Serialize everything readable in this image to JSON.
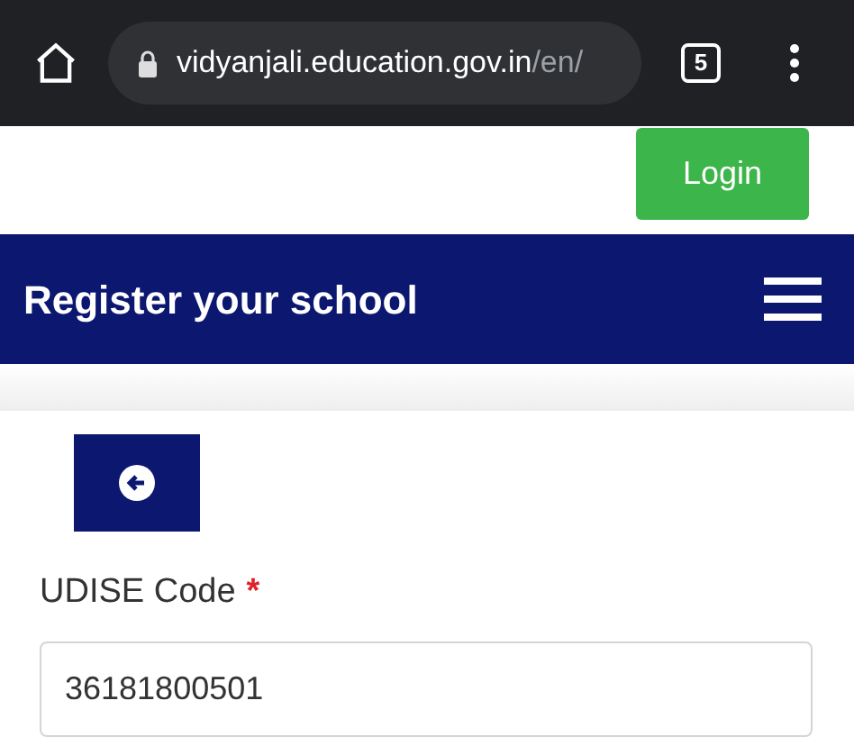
{
  "browser": {
    "url_host": "vidyanjali.education.gov.in",
    "url_path": "/en/",
    "tab_count": "5"
  },
  "top_bar": {
    "login_button": "Login"
  },
  "header": {
    "title": "Register your school"
  },
  "form": {
    "fields": [
      {
        "label": "UDISE Code",
        "required_mark": "*",
        "value": "36181800501"
      }
    ]
  }
}
